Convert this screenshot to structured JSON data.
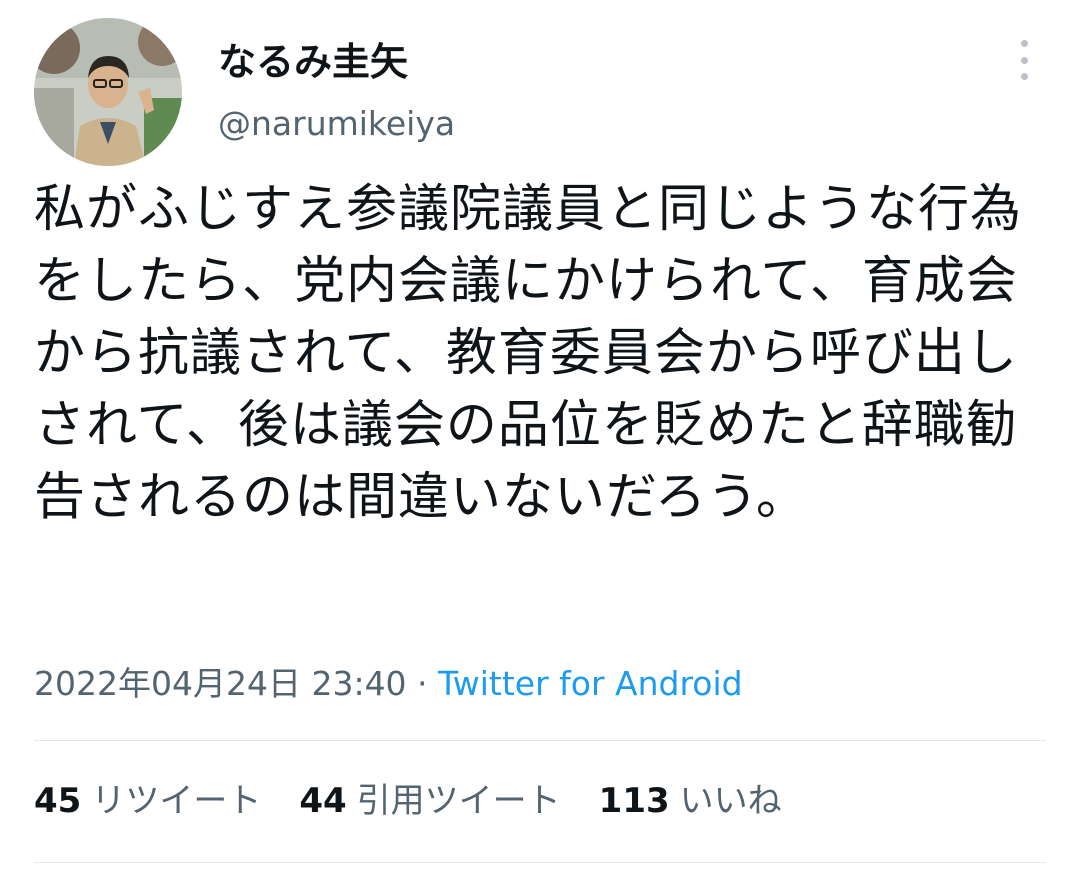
{
  "user": {
    "display_name": "なるみ圭矢",
    "handle": "@narumikeiya"
  },
  "tweet": {
    "text": "私がふじすえ参議院議員と同じような行為をしたら、党内会議にかけられて、育成会から抗議されて、教育委員会から呼び出しされて、後は議会の品位を貶めたと辞職勧告されるのは間違いないだろう。",
    "timestamp": "2022年04月24日 23:40",
    "separator": " · ",
    "source": "Twitter for Android"
  },
  "stats": [
    {
      "count": "45",
      "label": "リツイート"
    },
    {
      "count": "44",
      "label": "引用ツイート"
    },
    {
      "count": "113",
      "label": "いいね"
    }
  ],
  "colors": {
    "text": "#0f1419",
    "secondary": "#536471",
    "link": "#1d9bf0",
    "divider": "#e3e7ea"
  },
  "icons": {
    "more": "more-vertical-icon"
  }
}
